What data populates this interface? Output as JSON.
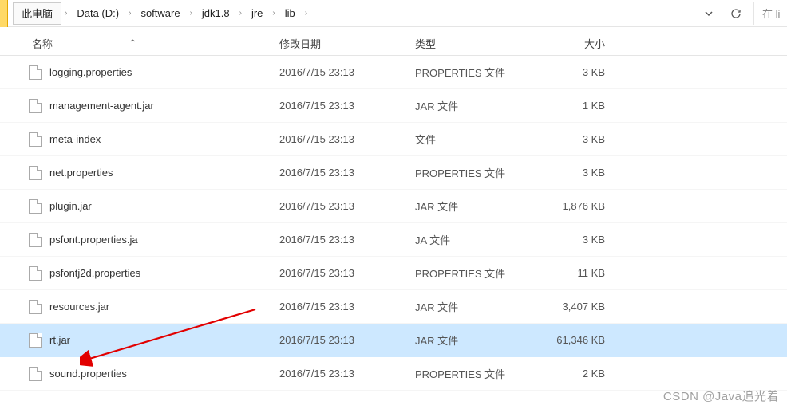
{
  "breadcrumb": {
    "items": [
      {
        "label": "此电脑",
        "boxed": true
      },
      {
        "label": "Data (D:)"
      },
      {
        "label": "software"
      },
      {
        "label": "jdk1.8"
      },
      {
        "label": "jre"
      },
      {
        "label": "lib"
      }
    ]
  },
  "search": {
    "placeholder": "在 li"
  },
  "columns": {
    "name": "名称",
    "date": "修改日期",
    "type": "类型",
    "size": "大小"
  },
  "files": [
    {
      "name": "logging.properties",
      "date": "2016/7/15 23:13",
      "type": "PROPERTIES 文件",
      "size": "3 KB",
      "selected": false
    },
    {
      "name": "management-agent.jar",
      "date": "2016/7/15 23:13",
      "type": "JAR 文件",
      "size": "1 KB",
      "selected": false
    },
    {
      "name": "meta-index",
      "date": "2016/7/15 23:13",
      "type": "文件",
      "size": "3 KB",
      "selected": false
    },
    {
      "name": "net.properties",
      "date": "2016/7/15 23:13",
      "type": "PROPERTIES 文件",
      "size": "3 KB",
      "selected": false
    },
    {
      "name": "plugin.jar",
      "date": "2016/7/15 23:13",
      "type": "JAR 文件",
      "size": "1,876 KB",
      "selected": false
    },
    {
      "name": "psfont.properties.ja",
      "date": "2016/7/15 23:13",
      "type": "JA 文件",
      "size": "3 KB",
      "selected": false
    },
    {
      "name": "psfontj2d.properties",
      "date": "2016/7/15 23:13",
      "type": "PROPERTIES 文件",
      "size": "11 KB",
      "selected": false
    },
    {
      "name": "resources.jar",
      "date": "2016/7/15 23:13",
      "type": "JAR 文件",
      "size": "3,407 KB",
      "selected": false
    },
    {
      "name": "rt.jar",
      "date": "2016/7/15 23:13",
      "type": "JAR 文件",
      "size": "61,346 KB",
      "selected": true
    },
    {
      "name": "sound.properties",
      "date": "2016/7/15 23:13",
      "type": "PROPERTIES 文件",
      "size": "2 KB",
      "selected": false
    }
  ],
  "watermark": "CSDN @Java追光着"
}
